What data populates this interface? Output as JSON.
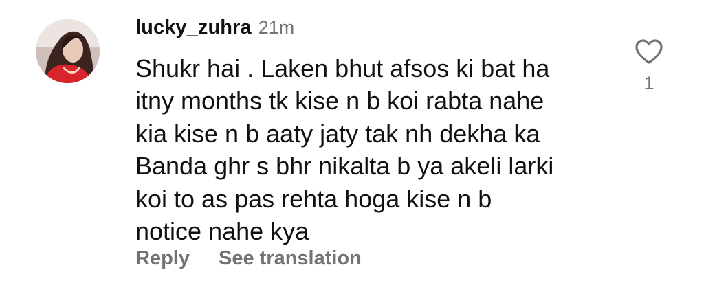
{
  "comment": {
    "username": "lucky_zuhra",
    "time": "21m",
    "lines": [
      "Shukr hai . Laken bhut afsos ki bat ha",
      "itny months tk kise n b koi rabta nahe",
      "kia kise n b aaty jaty tak nh dekha ka",
      "Banda ghr s bhr nikalta b ya akeli larki",
      "koi to as pas rehta hoga kise n b",
      "notice nahe kya"
    ],
    "reply_label": "Reply",
    "translate_label": "See translation",
    "like_count": "1",
    "like_icon": "heart-outline-icon"
  },
  "colors": {
    "text": "#111111",
    "secondary": "#737373",
    "background": "#ffffff"
  }
}
